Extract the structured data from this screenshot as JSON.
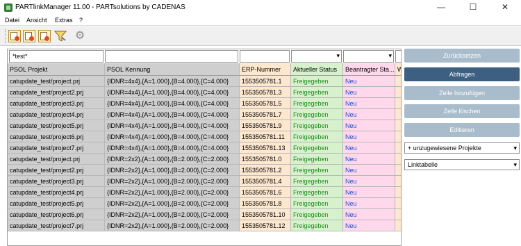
{
  "window": {
    "title": "PARTlinkManager 11.00 - PARTsolutions by CADENAS",
    "minimize": "—",
    "maximize": "☐",
    "close": "✕"
  },
  "menu": [
    "Datei",
    "Ansicht",
    "Extras",
    "?"
  ],
  "toolbar": {
    "icons": [
      "document-export-icon",
      "document-chart-icon",
      "document-import-icon",
      "filter-icon",
      "gear-icon"
    ]
  },
  "grid": {
    "filters": {
      "projekt": "*test*",
      "kennung": "",
      "erp": "",
      "status": "",
      "beantragter": ""
    },
    "columns": [
      "PSOL Projekt",
      "PSOL Kennung",
      "ERP-Nummer",
      "Aktueller Status",
      "Beantragter Sta...",
      "W"
    ],
    "rows": [
      [
        "catupdate_test/project.prj",
        "{IDNR=4x4},{A=1.000},{B=4.000},{C=4.000}",
        "1553505781.1",
        "Freigegeben",
        "Neu"
      ],
      [
        "catupdate_test/project2.prj",
        "{IDNR=4x4},{A=1.000},{B=4.000},{C=4.000}",
        "1553505781.3",
        "Freigegeben",
        "Neu"
      ],
      [
        "catupdate_test/project3.prj",
        "{IDNR=4x4},{A=1.000},{B=4.000},{C=4.000}",
        "1553505781.5",
        "Freigegeben",
        "Neu"
      ],
      [
        "catupdate_test/project4.prj",
        "{IDNR=4x4},{A=1.000},{B=4.000},{C=4.000}",
        "1553505781.7",
        "Freigegeben",
        "Neu"
      ],
      [
        "catupdate_test/project5.prj",
        "{IDNR=4x4},{A=1.000},{B=4.000},{C=4.000}",
        "1553505781.9",
        "Freigegeben",
        "Neu"
      ],
      [
        "catupdate_test/project6.prj",
        "{IDNR=4x4},{A=1.000},{B=4.000},{C=4.000}",
        "1553505781.11",
        "Freigegeben",
        "Neu"
      ],
      [
        "catupdate_test/project7.prj",
        "{IDNR=4x4},{A=1.000},{B=4.000},{C=4.000}",
        "1553505781.13",
        "Freigegeben",
        "Neu"
      ],
      [
        "catupdate_test/project.prj",
        "{IDNR=2x2},{A=1.000},{B=2.000},{C=2.000}",
        "1553505781.0",
        "Freigegeben",
        "Neu"
      ],
      [
        "catupdate_test/project2.prj",
        "{IDNR=2x2},{A=1.000},{B=2.000},{C=2.000}",
        "1553505781.2",
        "Freigegeben",
        "Neu"
      ],
      [
        "catupdate_test/project3.prj",
        "{IDNR=2x2},{A=1.000},{B=2.000},{C=2.000}",
        "1553505781.4",
        "Freigegeben",
        "Neu"
      ],
      [
        "catupdate_test/project4.prj",
        "{IDNR=2x2},{A=1.000},{B=2.000},{C=2.000}",
        "1553505781.6",
        "Freigegeben",
        "Neu"
      ],
      [
        "catupdate_test/project5.prj",
        "{IDNR=2x2},{A=1.000},{B=2.000},{C=2.000}",
        "1553505781.8",
        "Freigegeben",
        "Neu"
      ],
      [
        "catupdate_test/project6.prj",
        "{IDNR=2x2},{A=1.000},{B=2.000},{C=2.000}",
        "1553505781.10",
        "Freigegeben",
        "Neu"
      ],
      [
        "catupdate_test/project7.prj",
        "{IDNR=2x2},{A=1.000},{B=2.000},{C=2.000}",
        "1553505781.12",
        "Freigegeben",
        "Neu"
      ]
    ]
  },
  "actions": {
    "reset": "Zurücksetzen",
    "query": "Abfragen",
    "add_row": "Zeile hinzufügen",
    "delete_row": "Zeile löschen",
    "edit": "Editieren"
  },
  "options": {
    "project_filter": "+ unzugewiesene Projekte",
    "table_mode": "Linktabelle"
  },
  "colors": {
    "primary_button": "#3c5f82",
    "button": "#a9bccb",
    "status_green": "#1e8b1e",
    "requested_blue": "#1a4bc8"
  }
}
